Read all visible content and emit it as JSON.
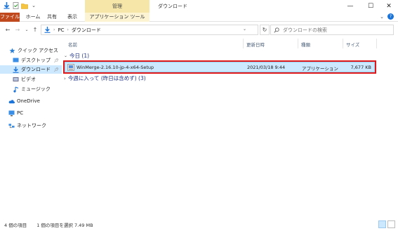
{
  "titlebar": {
    "manage_tab": "管理",
    "title": "ダウンロード",
    "minimize": "—",
    "maximize": "☐",
    "close": "✕"
  },
  "ribbon": {
    "tabs": [
      "ファイル",
      "ホーム",
      "共有",
      "表示",
      "アプリケーション ツール"
    ],
    "collapse": "⌄",
    "help": "?"
  },
  "nav": {
    "back": "←",
    "forward": "→",
    "recent": "⌄",
    "up": "↑",
    "breadcrumb": [
      "PC",
      "ダウンロード"
    ],
    "address_dropdown": "⌄",
    "refresh": "↻",
    "search_placeholder": "ダウンロードの検索"
  },
  "sidebar": {
    "items": [
      {
        "label": "クイック アクセス"
      },
      {
        "label": "デスクトップ"
      },
      {
        "label": "ダウンロード"
      },
      {
        "label": "ビデオ"
      },
      {
        "label": "ミュージック"
      },
      {
        "label": "OneDrive"
      },
      {
        "label": "PC"
      },
      {
        "label": "ネットワーク"
      }
    ]
  },
  "columns": {
    "name": "名前",
    "date": "更新日時",
    "type": "種類",
    "size": "サイズ"
  },
  "groups": {
    "today": "今日 (1)",
    "this_week": "今週に入って (昨日は含めず) (3)"
  },
  "file": {
    "name": "WinMerge-2.16.10-jp-4-x64-Setup",
    "date": "2021/03/18 9:44",
    "type": "アプリケーション",
    "size": "7,677 KB"
  },
  "status": {
    "item_count": "4 個の項目",
    "selection": "1 個の項目を選択  7.49 MB"
  },
  "colors": {
    "accent": "#0078d7",
    "selection": "#cce8ff",
    "highlight_border": "#e01818",
    "file_tab": "#c04a1e",
    "manage_tab": "#f6e7a8"
  }
}
